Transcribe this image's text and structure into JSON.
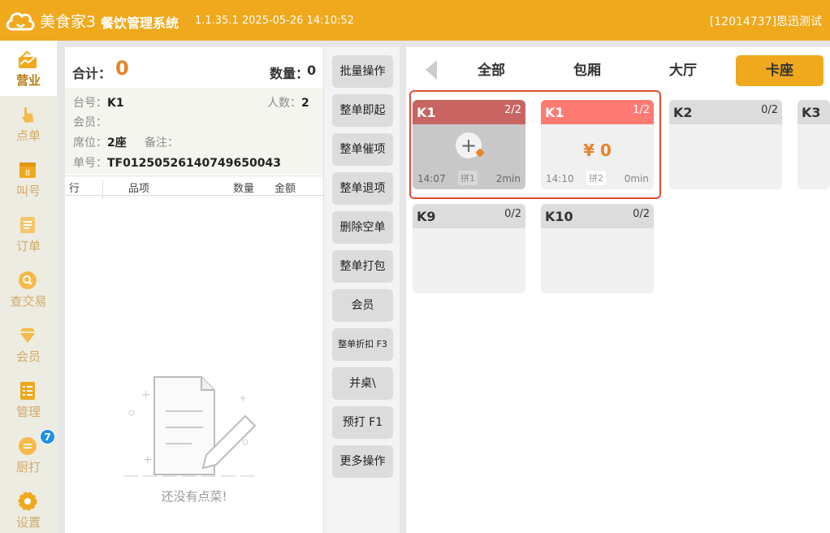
{
  "app": {
    "brand": "美食家3",
    "name": "餐饮管理系统",
    "version": "1.1.35.1 2025-05-26 14:10:52",
    "user": "[12014737]思迅测试",
    "colors": {
      "accent": "#f0a81c",
      "amount": "#e8832a",
      "occupied": "#c86461",
      "occupied_light": "#ff7a73",
      "selection": "#e04b35"
    }
  },
  "sidebar": {
    "items": [
      {
        "label": "营业",
        "icon": "chart-up-icon",
        "active": true
      },
      {
        "label": "点单",
        "icon": "hand-pointer-icon"
      },
      {
        "label": "叫号",
        "icon": "calling-number-icon"
      },
      {
        "label": "订单",
        "icon": "document-list-icon"
      },
      {
        "label": "查交易",
        "icon": "search-circle-icon"
      },
      {
        "label": "会员",
        "icon": "diamond-icon"
      },
      {
        "label": "管理",
        "icon": "clipboard-list-icon"
      },
      {
        "label": "厨打",
        "icon": "kitchen-print-icon",
        "badge": "7"
      },
      {
        "label": "设置",
        "icon": "gear-icon"
      }
    ]
  },
  "order": {
    "total_label": "合计：",
    "total_value": "0",
    "qty_label": "数量：",
    "qty_value": "0",
    "table_label": "台号：",
    "table_value": "K1",
    "people_label": "人数：",
    "people_value": "2",
    "member_label": "会员：",
    "seat_label": "席位：",
    "seat_value": "2座",
    "note_label": "备注：",
    "order_no_label": "单号：",
    "order_no_value": "TF01250526140749650043",
    "columns": [
      "行",
      "品项",
      "数量",
      "金额"
    ],
    "empty_text": "还没有点菜!"
  },
  "actions": [
    "批量操作",
    "整单即起",
    "整单催项",
    "整单退项",
    "删除空单",
    "整单打包",
    "会员",
    "整单折扣 F3",
    "并桌\\",
    "预打 F1",
    "更多操作"
  ],
  "tabs": {
    "items": [
      "全部",
      "包厢",
      "大厅",
      "卡座"
    ],
    "active": "卡座"
  },
  "tables": [
    {
      "name": "K1",
      "count": "2/2",
      "status": "occupied",
      "time": "14:07",
      "pin": "拼1",
      "duration": "2min"
    },
    {
      "name": "K1",
      "count": "1/2",
      "status": "occupied-light",
      "amount": "¥ 0",
      "time": "14:10",
      "pin": "拼2",
      "duration": "0min"
    },
    {
      "name": "K2",
      "count": "0/2",
      "status": "free"
    },
    {
      "name": "K3",
      "status": "free"
    },
    {
      "name": "K9",
      "count": "0/2",
      "status": "free"
    },
    {
      "name": "K10",
      "count": "0/2",
      "status": "free"
    }
  ]
}
